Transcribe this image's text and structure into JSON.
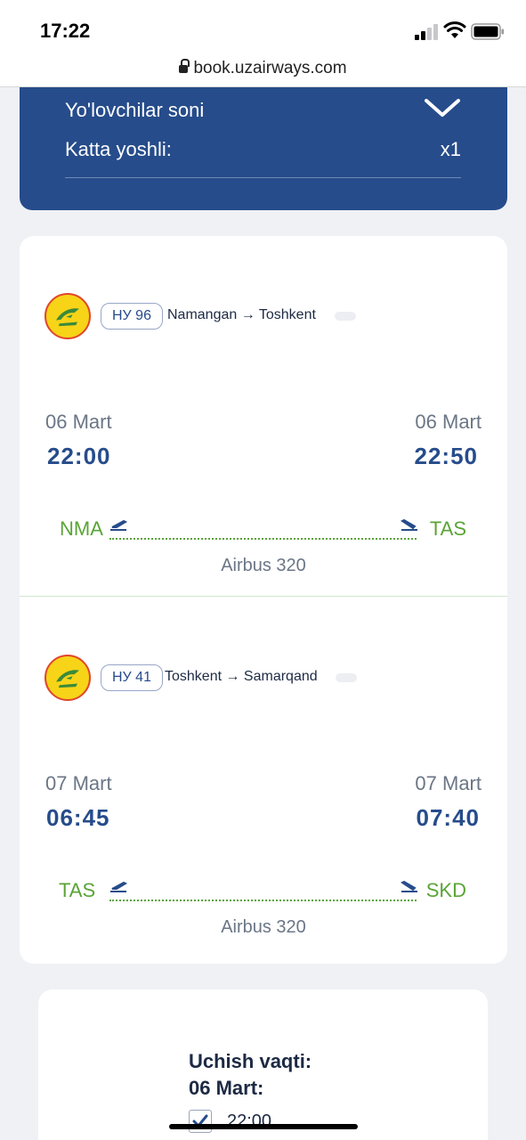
{
  "status": {
    "time": "17:22"
  },
  "browser": {
    "url": "book.uzairways.com"
  },
  "passengers": {
    "title": "Yo'lovchilar soni",
    "adult_label": "Katta yoshli:",
    "adult_count": "x1"
  },
  "segments": [
    {
      "flight_no": "НУ 96",
      "route": "Namangan → Toshkent",
      "dep_date": "06 Mart",
      "dep_time": "22:00",
      "arr_date": "06 Mart",
      "arr_time": "22:50",
      "dep_code": "NMA",
      "arr_code": "TAS",
      "aircraft": "Airbus 320"
    },
    {
      "flight_no": "НУ 41",
      "route": "Toshkent → Samarqand",
      "dep_date": "07 Mart",
      "dep_time": "06:45",
      "arr_date": "07 Mart",
      "arr_time": "07:40",
      "dep_code": "TAS",
      "arr_code": "SKD",
      "aircraft": "Airbus 320"
    }
  ],
  "departure_time": {
    "label_line1": "Uchish vaqti:",
    "label_line2": "06 Mart:",
    "option": "22:00"
  },
  "colors": {
    "primary": "#264c8b",
    "accent_green": "#5aa436",
    "background": "#eff1f5"
  }
}
